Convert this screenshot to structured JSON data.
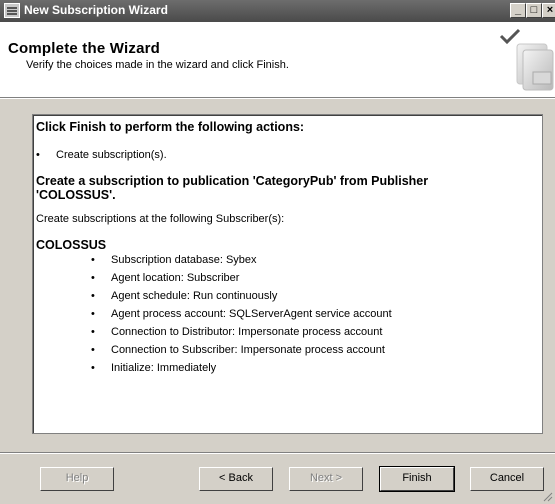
{
  "window": {
    "title": "New Subscription Wizard",
    "controls": {
      "minimize": "_",
      "maximize": "□",
      "close": "×"
    }
  },
  "header": {
    "title": "Complete the Wizard",
    "subtitle": "Verify the choices made in the wizard and click Finish."
  },
  "summary": {
    "heading": "Click Finish to perform the following actions:",
    "actions": [
      "Create subscription(s)."
    ],
    "publication_line_1": "Create a subscription to publication 'CategoryPub' from Publisher",
    "publication_line_2": "'COLOSSUS'.",
    "subscribers_intro": "Create subscriptions at the following Subscriber(s):",
    "subscriber_name": "COLOSSUS",
    "details": [
      "Subscription database: Sybex",
      "Agent location: Subscriber",
      "Agent schedule: Run continuously",
      "Agent process account: SQLServerAgent service account",
      "Connection to Distributor: Impersonate process account",
      "Connection to Subscriber: Impersonate process account",
      "Initialize: Immediately"
    ],
    "bullet_char": "•"
  },
  "buttons": {
    "help": "Help",
    "back": "< Back",
    "next": "Next >",
    "finish": "Finish",
    "cancel": "Cancel"
  }
}
